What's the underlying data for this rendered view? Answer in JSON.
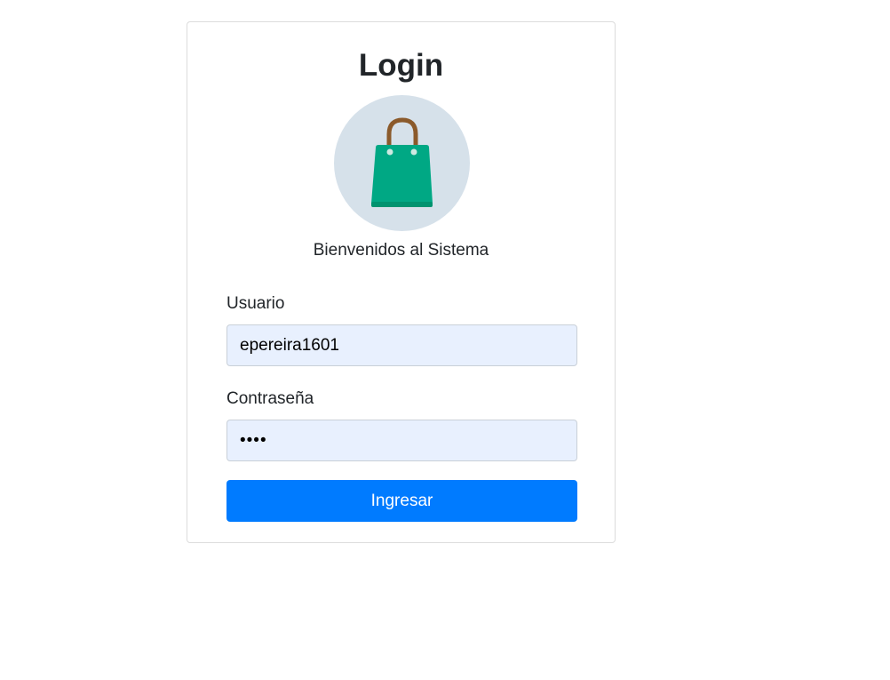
{
  "login": {
    "title": "Login",
    "logo_icon": "shopping-bag-icon",
    "subtitle": "Bienvenidos al Sistema",
    "username_label": "Usuario",
    "username_value": "epereira1601",
    "password_label": "Contraseña",
    "password_value": "••••",
    "submit_label": "Ingresar"
  },
  "colors": {
    "accent": "#007bff",
    "input_autofill": "#e8f0fe",
    "logo_circle": "#d6e1ea",
    "bag_green": "#00a884",
    "bag_handle": "#8b5a2b"
  }
}
